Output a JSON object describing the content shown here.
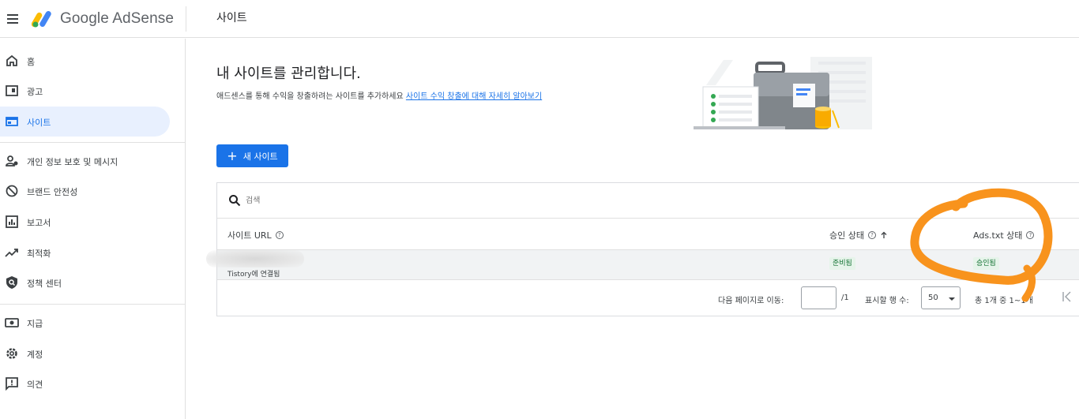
{
  "app": {
    "title": "Google AdSense",
    "page_title": "사이트"
  },
  "sidebar": {
    "items": [
      {
        "label": "홈",
        "icon": "home-icon"
      },
      {
        "label": "광고",
        "icon": "ads-icon"
      },
      {
        "label": "사이트",
        "icon": "sites-icon",
        "active": true
      },
      {
        "label": "개인 정보 보호 및 메시지",
        "icon": "privacy-icon"
      },
      {
        "label": "브랜드 안전성",
        "icon": "block-icon"
      },
      {
        "label": "보고서",
        "icon": "reports-icon"
      },
      {
        "label": "최적화",
        "icon": "trending-icon"
      },
      {
        "label": "정책 센터",
        "icon": "policy-icon"
      },
      {
        "label": "지급",
        "icon": "payments-icon"
      },
      {
        "label": "계정",
        "icon": "gear-icon"
      },
      {
        "label": "의견",
        "icon": "feedback-icon"
      }
    ]
  },
  "main": {
    "heading": "내 사이트를 관리합니다.",
    "subtitle": "애드센스를 통해 수익을 창출하려는 사이트를 추가하세요",
    "learn_more_link": "사이트 수익 창출에 대해 자세히 알아보기",
    "new_site_button": "새 사이트"
  },
  "table": {
    "search_placeholder": "검색",
    "columns": {
      "url": "사이트 URL",
      "approval": "승인 상태",
      "ads_txt": "Ads.txt 상태"
    },
    "rows": [
      {
        "url": "",
        "connected": "Tistory에 연결됨",
        "approval": "준비됨",
        "ads_txt": "승인됨"
      }
    ]
  },
  "pager": {
    "goto_label": "다음 페이지로 이동:",
    "page_value": "",
    "total_pages": "/1",
    "rows_label": "표시할 행 수:",
    "rows_value": "50",
    "range": "총 1개 중 1~1개"
  },
  "colors": {
    "accent": "#1a73e8",
    "annotation": "#f8931d",
    "success": "#137333"
  }
}
